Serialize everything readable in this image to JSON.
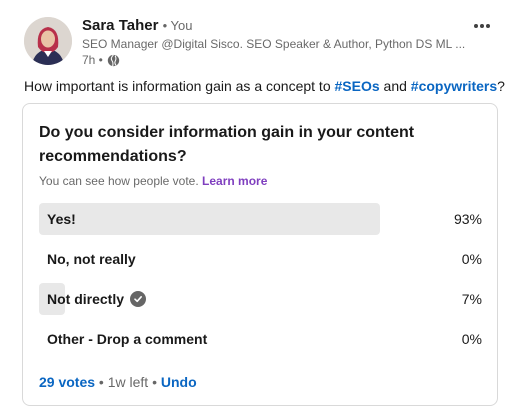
{
  "post": {
    "author_name": "Sara Taher",
    "author_badge": "• You",
    "headline": "SEO Manager @Digital Sisco. SEO Speaker & Author, Python DS ML ...",
    "time": "7h •",
    "text_before": "How important is information gain as a concept to ",
    "hashtag_1": "#SEOs",
    "text_middle": " and ",
    "hashtag_2": "#copywriters",
    "text_after": "?"
  },
  "poll": {
    "question": "Do you consider information gain in your content recommendations?",
    "visibility_text": "You can see how people vote. ",
    "learn_more": "Learn more",
    "options": [
      {
        "label": "Yes!",
        "percent": "93%",
        "fraction": 0.93,
        "selected": false
      },
      {
        "label": "No, not really",
        "percent": "0%",
        "fraction": 0.0,
        "selected": false
      },
      {
        "label": "Not directly",
        "percent": "7%",
        "fraction": 0.07,
        "selected": true
      },
      {
        "label": "Other - Drop a comment",
        "percent": "0%",
        "fraction": 0.0,
        "selected": false
      }
    ],
    "votes": "29 votes",
    "time_left": " • 1w left • ",
    "undo": "Undo"
  },
  "icons": {
    "more": "more-options-icon",
    "globe": "globe-icon",
    "check": "check-circle-icon"
  },
  "colors": {
    "link": "#0a66c2",
    "learn_more": "#7f3fbf",
    "bar_fill": "#e8e8e8"
  }
}
